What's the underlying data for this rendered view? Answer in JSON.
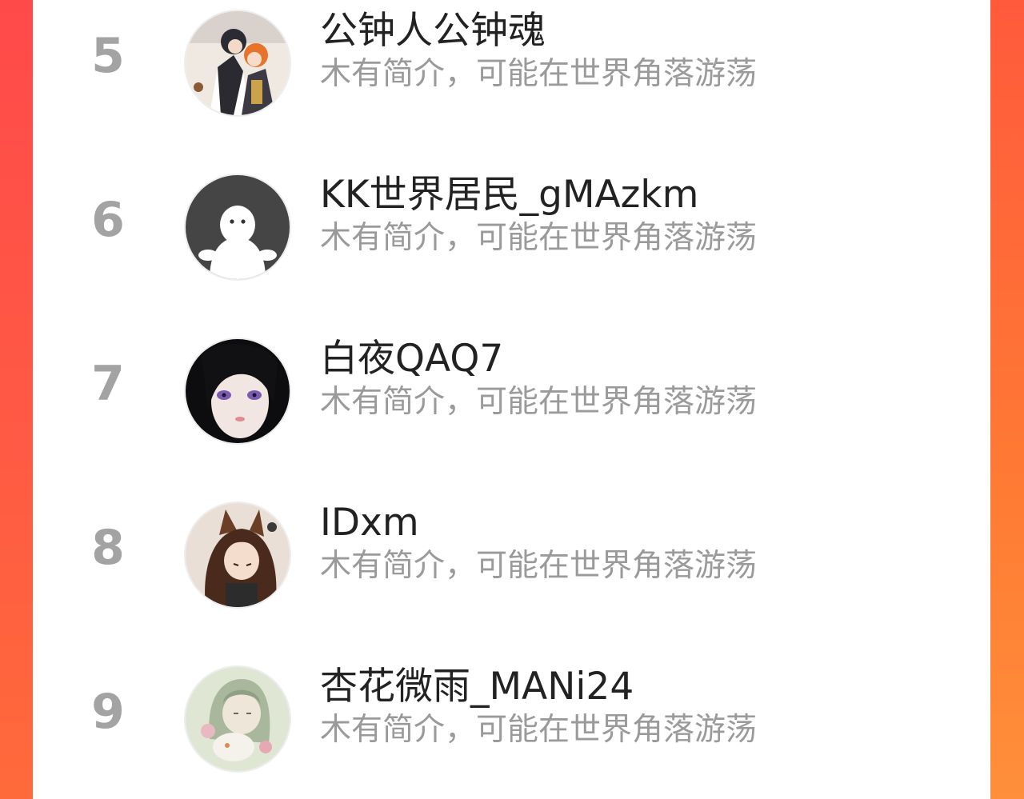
{
  "ranking": {
    "items": [
      {
        "rank": "5",
        "name": "公钟人公钟魂",
        "description": "木有简介，可能在世界角落游荡",
        "avatar_icon": "anime-couple-avatar-icon"
      },
      {
        "rank": "6",
        "name": "KK世界居民_gMAzkm",
        "description": "木有简介，可能在世界角落游荡",
        "avatar_icon": "default-ghost-avatar-icon"
      },
      {
        "rank": "7",
        "name": "白夜QAQ7",
        "description": "木有简介，可能在世界角落游荡",
        "avatar_icon": "dark-hair-girl-avatar-icon"
      },
      {
        "rank": "8",
        "name": "IDxm",
        "description": "木有简介，可能在世界角落游荡",
        "avatar_icon": "fox-ear-girl-avatar-icon"
      },
      {
        "rank": "9",
        "name": "杏花微雨_MANi24",
        "description": "木有简介，可能在世界角落游荡",
        "avatar_icon": "pastel-girl-avatar-icon"
      }
    ]
  },
  "colors": {
    "background_gradient_top": "#ff4a4a",
    "background_gradient_bottom": "#ff6a3a",
    "panel": "#ffffff",
    "rank_text": "#a3a3a3",
    "name_text": "#222222",
    "description_text": "#9a9a9a"
  }
}
